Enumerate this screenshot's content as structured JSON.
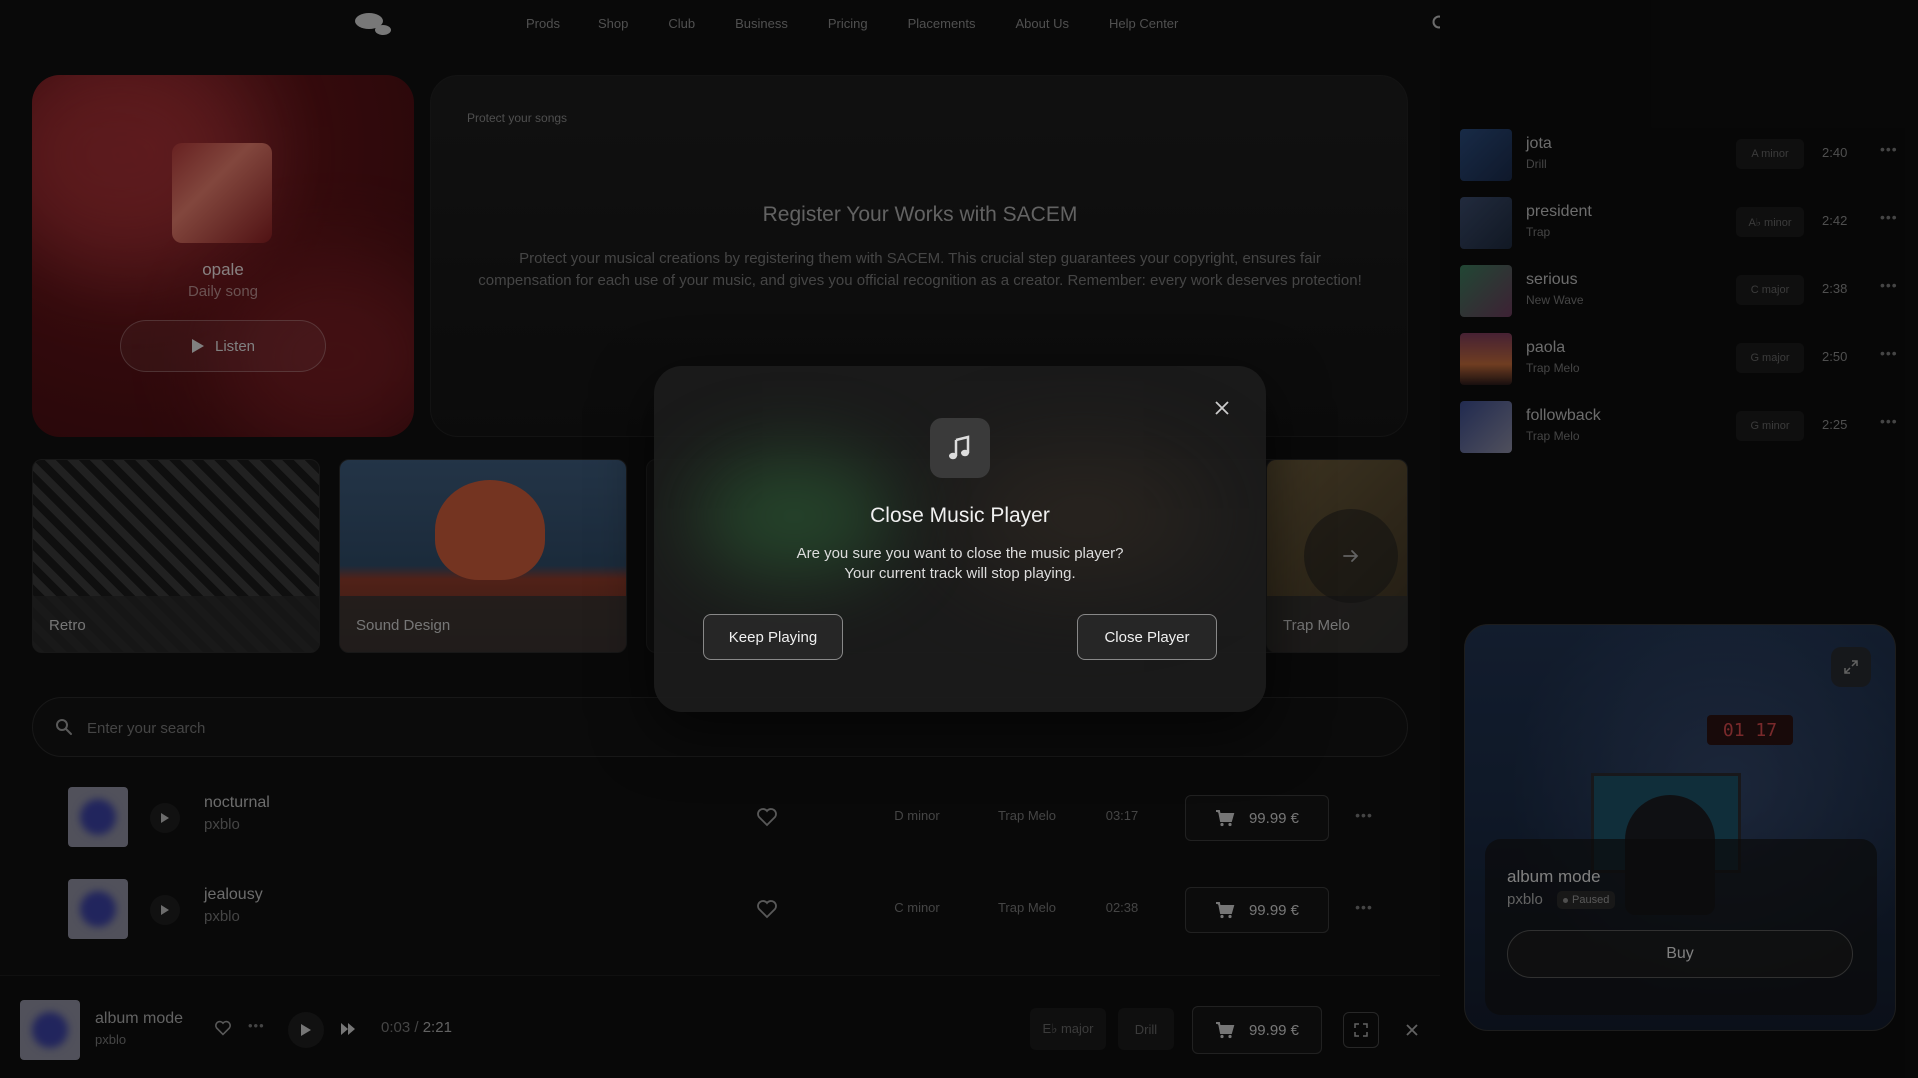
{
  "nav": {
    "links": [
      "Prods",
      "Shop",
      "Club",
      "Business",
      "Pricing",
      "Placements",
      "About Us",
      "Help Center"
    ]
  },
  "daily": {
    "title": "opale",
    "subtitle": "Daily song",
    "listen_label": "Listen"
  },
  "sacem": {
    "tag": "Protect your songs",
    "title": "Register Your Works with SACEM",
    "body": "Protect your musical creations by registering them with SACEM. This crucial step guarantees your copyright, ensures fair compensation for each use of your music, and gives you official recognition as a creator. Remember: every work deserves protection!"
  },
  "categories": [
    {
      "label": "Retro"
    },
    {
      "label": "Sound Design"
    },
    {
      "label": "Trap Melo"
    }
  ],
  "search": {
    "placeholder": "Enter your search"
  },
  "tracks": [
    {
      "title": "nocturnal",
      "artist": "pxblo",
      "key": "D minor",
      "genre": "Trap Melo",
      "duration": "03:17",
      "price": "99.99 €"
    },
    {
      "title": "jealousy",
      "artist": "pxblo",
      "key": "C minor",
      "genre": "Trap Melo",
      "duration": "02:38",
      "price": "99.99 €"
    }
  ],
  "sidebar": {
    "tracks": [
      {
        "name": "jota",
        "genre": "Drill",
        "key": "A minor",
        "duration": "2:40",
        "color": "#2a4a7a"
      },
      {
        "name": "president",
        "genre": "Trap",
        "key": "A♭ minor",
        "duration": "2:42",
        "color": "#3a4a6a"
      },
      {
        "name": "serious",
        "genre": "New Wave",
        "key": "C major",
        "duration": "2:38",
        "color": "#3a7a5a"
      },
      {
        "name": "paola",
        "genre": "Trap Melo",
        "key": "G major",
        "duration": "2:50",
        "color": "#7a3a3a"
      },
      {
        "name": "followback",
        "genre": "Trap Melo",
        "key": "G minor",
        "duration": "2:25",
        "color": "#3a4a8a"
      }
    ]
  },
  "album": {
    "title": "album mode",
    "artist": "pxblo",
    "status": "Paused",
    "clock": "01 17",
    "buy_label": "Buy"
  },
  "player": {
    "title": "album mode",
    "artist": "pxblo",
    "current_time": "0:03",
    "separator": " / ",
    "total_time": "2:21",
    "key": "E♭ major",
    "genre": "Drill",
    "price": "99.99 €"
  },
  "modal": {
    "title": "Close Music Player",
    "body": "Are you sure you want to close the music player? Your current track will stop playing.",
    "keep_label": "Keep Playing",
    "close_label": "Close Player"
  }
}
